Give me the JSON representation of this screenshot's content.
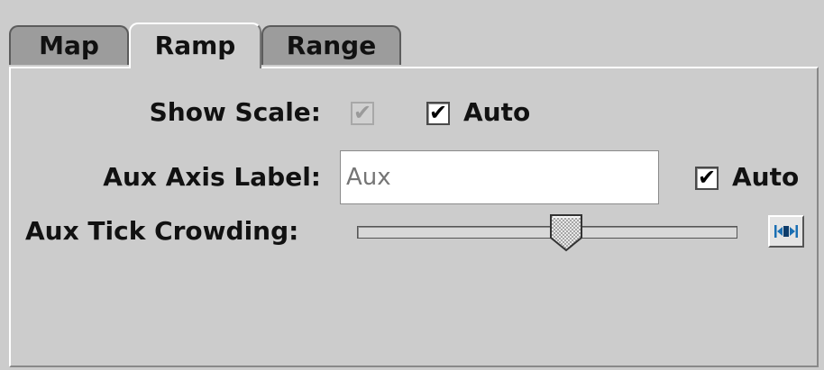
{
  "tabs": [
    {
      "label": "Map"
    },
    {
      "label": "Ramp",
      "active": true
    },
    {
      "label": "Range"
    }
  ],
  "show_scale": {
    "label": "Show Scale:",
    "checked": true,
    "enabled": false,
    "auto": {
      "label": "Auto",
      "checked": true
    }
  },
  "aux_axis_label": {
    "label": "Aux Axis Label:",
    "value": "",
    "placeholder": "Aux",
    "auto": {
      "label": "Auto",
      "checked": true
    }
  },
  "aux_tick_crowding": {
    "label": "Aux Tick Crowding:",
    "slider_fraction": 0.55,
    "reset_icon": "center-reset-icon"
  },
  "colors": {
    "background": "#cccccc",
    "tab_inactive": "#9c9c9c",
    "icon_accent": "#1a6fb3"
  }
}
